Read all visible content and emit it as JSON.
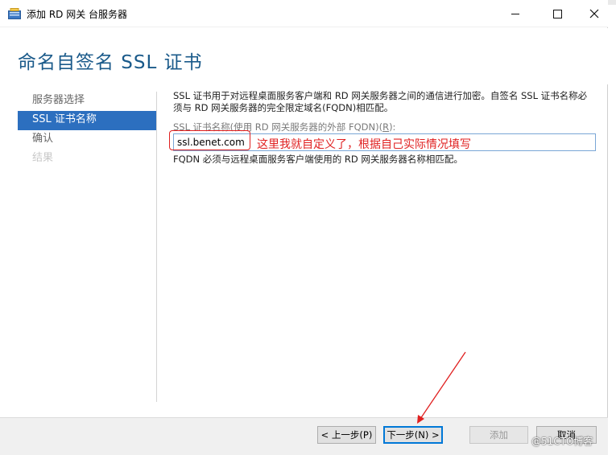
{
  "window": {
    "title": "添加 RD 网关 台服务器"
  },
  "header": {
    "title": "命名自签名 SSL 证书"
  },
  "nav": {
    "items": [
      {
        "label": "服务器选择",
        "state": "normal"
      },
      {
        "label": "SSL 证书名称",
        "state": "active"
      },
      {
        "label": "确认",
        "state": "normal"
      },
      {
        "label": "结果",
        "state": "disabled"
      }
    ]
  },
  "content": {
    "description": "SSL 证书用于对远程桌面服务客户端和 RD 网关服务器之间的通信进行加密。自签名 SSL 证书名称必须与 RD 网关服务器的完全限定域名(FQDN)相匹配。",
    "field_label": "SSL 证书名称(使用 RD 网关服务器的外部 FQDN)(",
    "field_label_key": "R",
    "field_label_end": "):",
    "field_value": "ssl.benet.com",
    "annotation": "这里我就自定义了，根据自己实际情况填写",
    "hint": "FQDN 必须与远程桌面服务客户端使用的 RD 网关服务器名称相匹配。"
  },
  "footer": {
    "prev_label": "< 上一步(P)",
    "next_label": "下一步(N) >",
    "add_label": "添加",
    "cancel_label": "取消"
  },
  "watermark": "@51CTO博客",
  "colors": {
    "accent": "#2c6fbf",
    "title": "#1a5a8a",
    "annotation": "#e02020"
  }
}
